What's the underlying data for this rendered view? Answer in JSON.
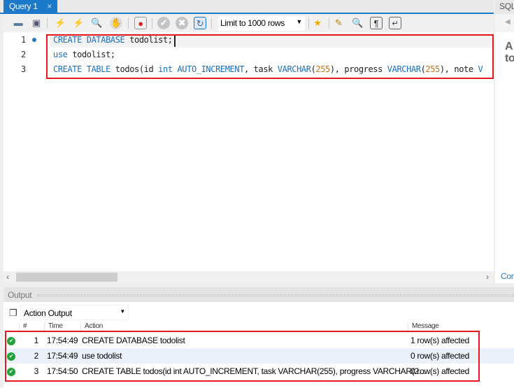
{
  "tabs": {
    "query_tab": "Query 1",
    "close": "×",
    "right_tab": "SQL"
  },
  "toolbar": {
    "limit": "Limit to 1000 rows"
  },
  "editor": {
    "lines": [
      {
        "no": "1",
        "parts": [
          [
            "kw",
            "CREATE DATABASE"
          ],
          [
            "",
            "todolist;"
          ]
        ]
      },
      {
        "no": "2",
        "parts": [
          [
            "kw",
            "use"
          ],
          [
            "",
            "todolist;"
          ]
        ]
      },
      {
        "no": "3",
        "parts": [
          [
            "kw",
            "CREATE TABLE"
          ],
          [
            "",
            "todos(id"
          ],
          [
            "kw",
            "int AUTO_INCREMENT"
          ],
          [
            "",
            ", task"
          ],
          [
            "kw",
            "VARCHAR"
          ],
          [
            "",
            "("
          ],
          [
            "num",
            "255"
          ],
          [
            "",
            "), progress"
          ],
          [
            "kw",
            "VARCHAR"
          ],
          [
            "",
            "("
          ],
          [
            "num",
            "255"
          ],
          [
            "",
            "), note"
          ],
          [
            "kw",
            "V"
          ]
        ]
      }
    ]
  },
  "right_panel": {
    "heading1": "A",
    "heading2": "to",
    "link": "Con"
  },
  "output": {
    "title": "Output",
    "selector": "Action Output",
    "columns": {
      "num": "#",
      "time": "Time",
      "action": "Action",
      "message": "Message"
    },
    "rows": [
      {
        "num": "1",
        "time": "17:54:49",
        "action": "CREATE DATABASE todolist",
        "message": "1 row(s) affected",
        "status": "success"
      },
      {
        "num": "2",
        "time": "17:54:49",
        "action": "use todolist",
        "message": "0 row(s) affected",
        "status": "success"
      },
      {
        "num": "3",
        "time": "17:54:50",
        "action": "CREATE TABLE todos(id int AUTO_INCREMENT, task VARCHAR(255), progress VARCHAR(2...",
        "message": "0 row(s) affected",
        "status": "success"
      }
    ]
  },
  "colors": {
    "accent": "#1c78c8",
    "highlight": "#e8161e",
    "success": "#22a23a"
  }
}
